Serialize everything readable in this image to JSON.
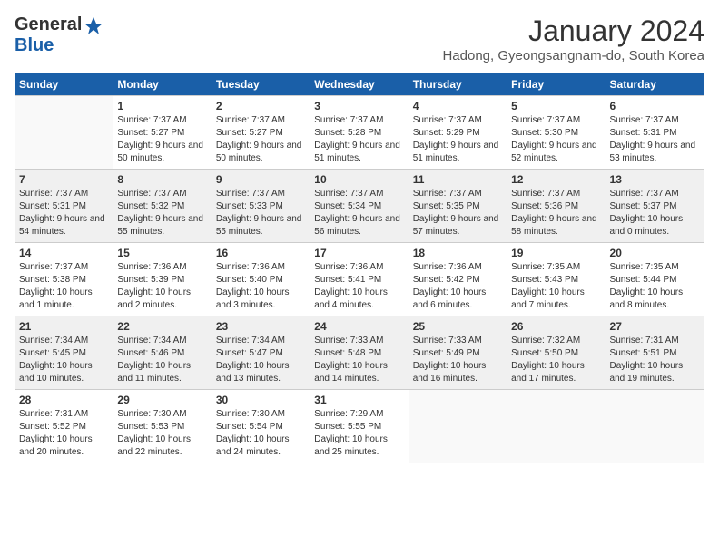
{
  "logo": {
    "general": "General",
    "blue": "Blue"
  },
  "header": {
    "month": "January 2024",
    "location": "Hadong, Gyeongsangnam-do, South Korea"
  },
  "days": [
    "Sunday",
    "Monday",
    "Tuesday",
    "Wednesday",
    "Thursday",
    "Friday",
    "Saturday"
  ],
  "weeks": [
    [
      {
        "day": "",
        "sunrise": "",
        "sunset": "",
        "daylight": ""
      },
      {
        "day": "1",
        "sunrise": "Sunrise: 7:37 AM",
        "sunset": "Sunset: 5:27 PM",
        "daylight": "Daylight: 9 hours and 50 minutes."
      },
      {
        "day": "2",
        "sunrise": "Sunrise: 7:37 AM",
        "sunset": "Sunset: 5:27 PM",
        "daylight": "Daylight: 9 hours and 50 minutes."
      },
      {
        "day": "3",
        "sunrise": "Sunrise: 7:37 AM",
        "sunset": "Sunset: 5:28 PM",
        "daylight": "Daylight: 9 hours and 51 minutes."
      },
      {
        "day": "4",
        "sunrise": "Sunrise: 7:37 AM",
        "sunset": "Sunset: 5:29 PM",
        "daylight": "Daylight: 9 hours and 51 minutes."
      },
      {
        "day": "5",
        "sunrise": "Sunrise: 7:37 AM",
        "sunset": "Sunset: 5:30 PM",
        "daylight": "Daylight: 9 hours and 52 minutes."
      },
      {
        "day": "6",
        "sunrise": "Sunrise: 7:37 AM",
        "sunset": "Sunset: 5:31 PM",
        "daylight": "Daylight: 9 hours and 53 minutes."
      }
    ],
    [
      {
        "day": "7",
        "sunrise": "Sunrise: 7:37 AM",
        "sunset": "Sunset: 5:31 PM",
        "daylight": "Daylight: 9 hours and 54 minutes."
      },
      {
        "day": "8",
        "sunrise": "Sunrise: 7:37 AM",
        "sunset": "Sunset: 5:32 PM",
        "daylight": "Daylight: 9 hours and 55 minutes."
      },
      {
        "day": "9",
        "sunrise": "Sunrise: 7:37 AM",
        "sunset": "Sunset: 5:33 PM",
        "daylight": "Daylight: 9 hours and 55 minutes."
      },
      {
        "day": "10",
        "sunrise": "Sunrise: 7:37 AM",
        "sunset": "Sunset: 5:34 PM",
        "daylight": "Daylight: 9 hours and 56 minutes."
      },
      {
        "day": "11",
        "sunrise": "Sunrise: 7:37 AM",
        "sunset": "Sunset: 5:35 PM",
        "daylight": "Daylight: 9 hours and 57 minutes."
      },
      {
        "day": "12",
        "sunrise": "Sunrise: 7:37 AM",
        "sunset": "Sunset: 5:36 PM",
        "daylight": "Daylight: 9 hours and 58 minutes."
      },
      {
        "day": "13",
        "sunrise": "Sunrise: 7:37 AM",
        "sunset": "Sunset: 5:37 PM",
        "daylight": "Daylight: 10 hours and 0 minutes."
      }
    ],
    [
      {
        "day": "14",
        "sunrise": "Sunrise: 7:37 AM",
        "sunset": "Sunset: 5:38 PM",
        "daylight": "Daylight: 10 hours and 1 minute."
      },
      {
        "day": "15",
        "sunrise": "Sunrise: 7:36 AM",
        "sunset": "Sunset: 5:39 PM",
        "daylight": "Daylight: 10 hours and 2 minutes."
      },
      {
        "day": "16",
        "sunrise": "Sunrise: 7:36 AM",
        "sunset": "Sunset: 5:40 PM",
        "daylight": "Daylight: 10 hours and 3 minutes."
      },
      {
        "day": "17",
        "sunrise": "Sunrise: 7:36 AM",
        "sunset": "Sunset: 5:41 PM",
        "daylight": "Daylight: 10 hours and 4 minutes."
      },
      {
        "day": "18",
        "sunrise": "Sunrise: 7:36 AM",
        "sunset": "Sunset: 5:42 PM",
        "daylight": "Daylight: 10 hours and 6 minutes."
      },
      {
        "day": "19",
        "sunrise": "Sunrise: 7:35 AM",
        "sunset": "Sunset: 5:43 PM",
        "daylight": "Daylight: 10 hours and 7 minutes."
      },
      {
        "day": "20",
        "sunrise": "Sunrise: 7:35 AM",
        "sunset": "Sunset: 5:44 PM",
        "daylight": "Daylight: 10 hours and 8 minutes."
      }
    ],
    [
      {
        "day": "21",
        "sunrise": "Sunrise: 7:34 AM",
        "sunset": "Sunset: 5:45 PM",
        "daylight": "Daylight: 10 hours and 10 minutes."
      },
      {
        "day": "22",
        "sunrise": "Sunrise: 7:34 AM",
        "sunset": "Sunset: 5:46 PM",
        "daylight": "Daylight: 10 hours and 11 minutes."
      },
      {
        "day": "23",
        "sunrise": "Sunrise: 7:34 AM",
        "sunset": "Sunset: 5:47 PM",
        "daylight": "Daylight: 10 hours and 13 minutes."
      },
      {
        "day": "24",
        "sunrise": "Sunrise: 7:33 AM",
        "sunset": "Sunset: 5:48 PM",
        "daylight": "Daylight: 10 hours and 14 minutes."
      },
      {
        "day": "25",
        "sunrise": "Sunrise: 7:33 AM",
        "sunset": "Sunset: 5:49 PM",
        "daylight": "Daylight: 10 hours and 16 minutes."
      },
      {
        "day": "26",
        "sunrise": "Sunrise: 7:32 AM",
        "sunset": "Sunset: 5:50 PM",
        "daylight": "Daylight: 10 hours and 17 minutes."
      },
      {
        "day": "27",
        "sunrise": "Sunrise: 7:31 AM",
        "sunset": "Sunset: 5:51 PM",
        "daylight": "Daylight: 10 hours and 19 minutes."
      }
    ],
    [
      {
        "day": "28",
        "sunrise": "Sunrise: 7:31 AM",
        "sunset": "Sunset: 5:52 PM",
        "daylight": "Daylight: 10 hours and 20 minutes."
      },
      {
        "day": "29",
        "sunrise": "Sunrise: 7:30 AM",
        "sunset": "Sunset: 5:53 PM",
        "daylight": "Daylight: 10 hours and 22 minutes."
      },
      {
        "day": "30",
        "sunrise": "Sunrise: 7:30 AM",
        "sunset": "Sunset: 5:54 PM",
        "daylight": "Daylight: 10 hours and 24 minutes."
      },
      {
        "day": "31",
        "sunrise": "Sunrise: 7:29 AM",
        "sunset": "Sunset: 5:55 PM",
        "daylight": "Daylight: 10 hours and 25 minutes."
      },
      {
        "day": "",
        "sunrise": "",
        "sunset": "",
        "daylight": ""
      },
      {
        "day": "",
        "sunrise": "",
        "sunset": "",
        "daylight": ""
      },
      {
        "day": "",
        "sunrise": "",
        "sunset": "",
        "daylight": ""
      }
    ]
  ]
}
